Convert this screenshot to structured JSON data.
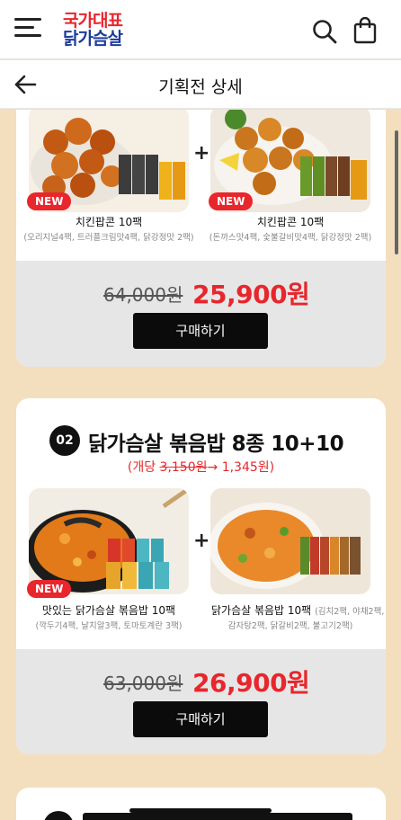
{
  "header": {
    "logo_line1": "국가대표",
    "logo_line2": "닭가슴살"
  },
  "subheader": {
    "title": "기획전 상세"
  },
  "card1": {
    "left_product": {
      "badge": "NEW",
      "name": "치킨팝콘 10팩",
      "desc": "(오리지널4팩, 트러플크림맛4팩, 닭강정맛 2팩)"
    },
    "plus": "+",
    "right_product": {
      "badge": "NEW",
      "name": "치킨팝콘 10팩",
      "desc": "(돈까스맛4팩, 숯불갈비맛4팩, 닭강정맛 2팩)"
    },
    "old_price": "64,000원",
    "new_price": "25,900원",
    "buy_label": "구매하기"
  },
  "card2": {
    "number": "02",
    "title": "닭가슴살 볶음밥 8종 10+10",
    "unit_prefix": "(개당 ",
    "unit_old": "3,150원",
    "unit_arrow": "→",
    "unit_new": " 1,345원)",
    "left_product": {
      "badge": "NEW",
      "name": "맛있는 닭가슴살 볶음밥 10팩",
      "desc": "(깍두기4팩, 날치알3팩, 토마토계란 3팩)"
    },
    "plus": "+",
    "right_product": {
      "name": "닭가슴살 볶음밥 10팩",
      "desc_inline": "(김치2팩, 야채2팩,",
      "desc_line2": "감자탕2팩, 닭갈비2팩, 불고기2팩)"
    },
    "old_price": "63,000원",
    "new_price": "26,900원",
    "buy_label": "구매하기"
  },
  "colors": {
    "accent": "#e8262c",
    "background": "#f3dfbe",
    "button": "#0b0b0b",
    "logo_blue": "#1d3d9c"
  },
  "icons": {
    "menu": "hamburger-icon",
    "search": "search-icon",
    "cart": "shopping-bag-icon",
    "back": "arrow-left-icon"
  }
}
